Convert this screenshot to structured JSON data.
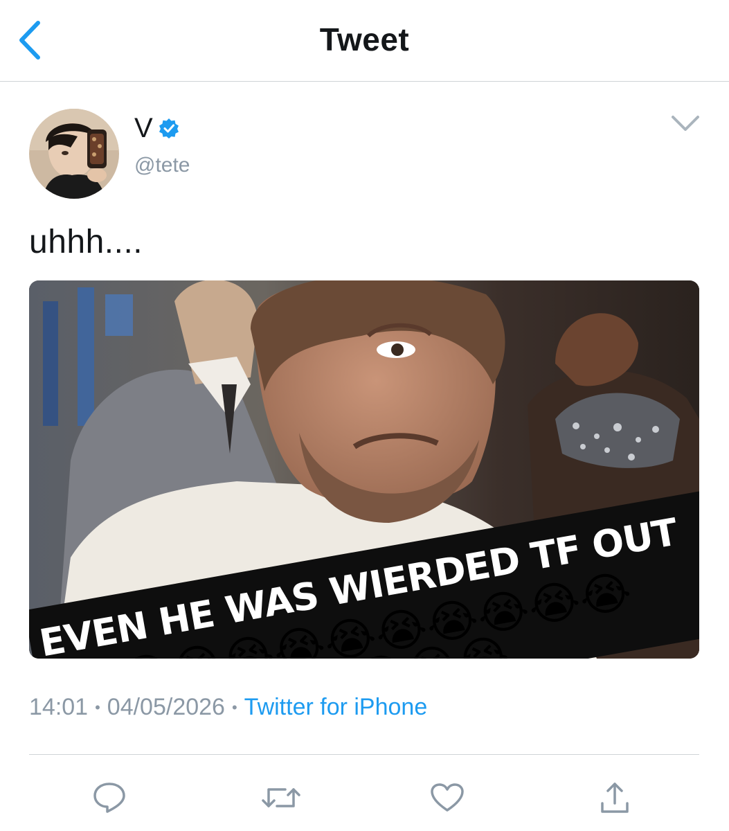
{
  "header": {
    "title": "Tweet",
    "back_icon": "chevron-left-icon"
  },
  "tweet": {
    "author": {
      "display_name": "V",
      "handle": "@tete",
      "verified": true,
      "verified_icon": "verified-badge-icon"
    },
    "text": "uhhh....",
    "media": {
      "overlay_text": "EVEN HE WAS WIERDED TF OUT",
      "emoji": "😭"
    },
    "meta": {
      "time": "14:01",
      "date": "04/05/2026",
      "source": "Twitter for iPhone"
    }
  },
  "actions": {
    "reply_icon": "reply-icon",
    "retweet_icon": "retweet-icon",
    "like_icon": "heart-icon",
    "share_icon": "share-icon"
  },
  "colors": {
    "accent": "#1d9bf0",
    "text": "#14171a",
    "muted": "#8b98a5",
    "divider": "#cfd3d6"
  }
}
